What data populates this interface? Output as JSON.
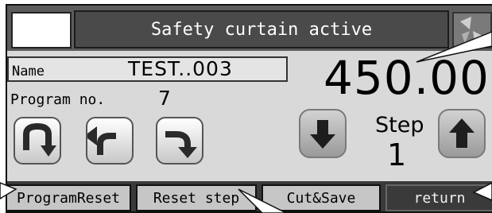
{
  "header": {
    "banner_text": "Safety curtain active"
  },
  "fields": {
    "name_label": "Name",
    "name_value": "TEST..003",
    "program_label": "Program no.",
    "program_value": "7"
  },
  "display": {
    "main_value": "450.00",
    "step_label": "Step",
    "step_value": "1"
  },
  "icons": {
    "u_turn": "u-turn-down-arrow-icon",
    "left_turn": "turn-left-arrow-icon",
    "right_turn": "turn-right-arrow-icon",
    "down": "arrow-down-icon",
    "up": "arrow-up-icon",
    "logo": "logo-icon"
  },
  "bottom_buttons": [
    {
      "label": "ProgramReset"
    },
    {
      "label": "Reset step"
    },
    {
      "label": "Cut&Save"
    },
    {
      "label": "return"
    }
  ]
}
